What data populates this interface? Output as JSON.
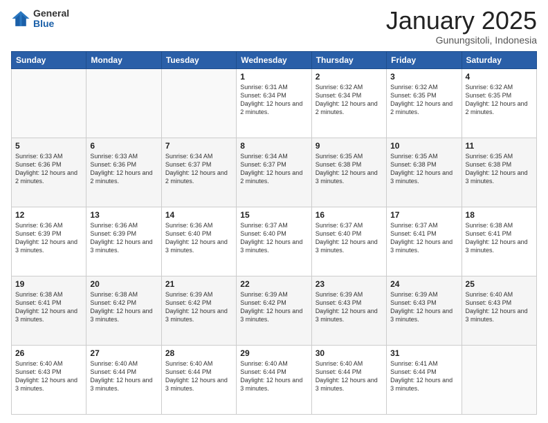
{
  "logo": {
    "general": "General",
    "blue": "Blue"
  },
  "header": {
    "title": "January 2025",
    "subtitle": "Gunungsitoli, Indonesia"
  },
  "days_of_week": [
    "Sunday",
    "Monday",
    "Tuesday",
    "Wednesday",
    "Thursday",
    "Friday",
    "Saturday"
  ],
  "weeks": [
    [
      {
        "day": "",
        "sunrise": "",
        "sunset": "",
        "daylight": ""
      },
      {
        "day": "",
        "sunrise": "",
        "sunset": "",
        "daylight": ""
      },
      {
        "day": "",
        "sunrise": "",
        "sunset": "",
        "daylight": ""
      },
      {
        "day": "1",
        "sunrise": "Sunrise: 6:31 AM",
        "sunset": "Sunset: 6:34 PM",
        "daylight": "Daylight: 12 hours and 2 minutes."
      },
      {
        "day": "2",
        "sunrise": "Sunrise: 6:32 AM",
        "sunset": "Sunset: 6:34 PM",
        "daylight": "Daylight: 12 hours and 2 minutes."
      },
      {
        "day": "3",
        "sunrise": "Sunrise: 6:32 AM",
        "sunset": "Sunset: 6:35 PM",
        "daylight": "Daylight: 12 hours and 2 minutes."
      },
      {
        "day": "4",
        "sunrise": "Sunrise: 6:32 AM",
        "sunset": "Sunset: 6:35 PM",
        "daylight": "Daylight: 12 hours and 2 minutes."
      }
    ],
    [
      {
        "day": "5",
        "sunrise": "Sunrise: 6:33 AM",
        "sunset": "Sunset: 6:36 PM",
        "daylight": "Daylight: 12 hours and 2 minutes."
      },
      {
        "day": "6",
        "sunrise": "Sunrise: 6:33 AM",
        "sunset": "Sunset: 6:36 PM",
        "daylight": "Daylight: 12 hours and 2 minutes."
      },
      {
        "day": "7",
        "sunrise": "Sunrise: 6:34 AM",
        "sunset": "Sunset: 6:37 PM",
        "daylight": "Daylight: 12 hours and 2 minutes."
      },
      {
        "day": "8",
        "sunrise": "Sunrise: 6:34 AM",
        "sunset": "Sunset: 6:37 PM",
        "daylight": "Daylight: 12 hours and 2 minutes."
      },
      {
        "day": "9",
        "sunrise": "Sunrise: 6:35 AM",
        "sunset": "Sunset: 6:38 PM",
        "daylight": "Daylight: 12 hours and 3 minutes."
      },
      {
        "day": "10",
        "sunrise": "Sunrise: 6:35 AM",
        "sunset": "Sunset: 6:38 PM",
        "daylight": "Daylight: 12 hours and 3 minutes."
      },
      {
        "day": "11",
        "sunrise": "Sunrise: 6:35 AM",
        "sunset": "Sunset: 6:38 PM",
        "daylight": "Daylight: 12 hours and 3 minutes."
      }
    ],
    [
      {
        "day": "12",
        "sunrise": "Sunrise: 6:36 AM",
        "sunset": "Sunset: 6:39 PM",
        "daylight": "Daylight: 12 hours and 3 minutes."
      },
      {
        "day": "13",
        "sunrise": "Sunrise: 6:36 AM",
        "sunset": "Sunset: 6:39 PM",
        "daylight": "Daylight: 12 hours and 3 minutes."
      },
      {
        "day": "14",
        "sunrise": "Sunrise: 6:36 AM",
        "sunset": "Sunset: 6:40 PM",
        "daylight": "Daylight: 12 hours and 3 minutes."
      },
      {
        "day": "15",
        "sunrise": "Sunrise: 6:37 AM",
        "sunset": "Sunset: 6:40 PM",
        "daylight": "Daylight: 12 hours and 3 minutes."
      },
      {
        "day": "16",
        "sunrise": "Sunrise: 6:37 AM",
        "sunset": "Sunset: 6:40 PM",
        "daylight": "Daylight: 12 hours and 3 minutes."
      },
      {
        "day": "17",
        "sunrise": "Sunrise: 6:37 AM",
        "sunset": "Sunset: 6:41 PM",
        "daylight": "Daylight: 12 hours and 3 minutes."
      },
      {
        "day": "18",
        "sunrise": "Sunrise: 6:38 AM",
        "sunset": "Sunset: 6:41 PM",
        "daylight": "Daylight: 12 hours and 3 minutes."
      }
    ],
    [
      {
        "day": "19",
        "sunrise": "Sunrise: 6:38 AM",
        "sunset": "Sunset: 6:41 PM",
        "daylight": "Daylight: 12 hours and 3 minutes."
      },
      {
        "day": "20",
        "sunrise": "Sunrise: 6:38 AM",
        "sunset": "Sunset: 6:42 PM",
        "daylight": "Daylight: 12 hours and 3 minutes."
      },
      {
        "day": "21",
        "sunrise": "Sunrise: 6:39 AM",
        "sunset": "Sunset: 6:42 PM",
        "daylight": "Daylight: 12 hours and 3 minutes."
      },
      {
        "day": "22",
        "sunrise": "Sunrise: 6:39 AM",
        "sunset": "Sunset: 6:42 PM",
        "daylight": "Daylight: 12 hours and 3 minutes."
      },
      {
        "day": "23",
        "sunrise": "Sunrise: 6:39 AM",
        "sunset": "Sunset: 6:43 PM",
        "daylight": "Daylight: 12 hours and 3 minutes."
      },
      {
        "day": "24",
        "sunrise": "Sunrise: 6:39 AM",
        "sunset": "Sunset: 6:43 PM",
        "daylight": "Daylight: 12 hours and 3 minutes."
      },
      {
        "day": "25",
        "sunrise": "Sunrise: 6:40 AM",
        "sunset": "Sunset: 6:43 PM",
        "daylight": "Daylight: 12 hours and 3 minutes."
      }
    ],
    [
      {
        "day": "26",
        "sunrise": "Sunrise: 6:40 AM",
        "sunset": "Sunset: 6:43 PM",
        "daylight": "Daylight: 12 hours and 3 minutes."
      },
      {
        "day": "27",
        "sunrise": "Sunrise: 6:40 AM",
        "sunset": "Sunset: 6:44 PM",
        "daylight": "Daylight: 12 hours and 3 minutes."
      },
      {
        "day": "28",
        "sunrise": "Sunrise: 6:40 AM",
        "sunset": "Sunset: 6:44 PM",
        "daylight": "Daylight: 12 hours and 3 minutes."
      },
      {
        "day": "29",
        "sunrise": "Sunrise: 6:40 AM",
        "sunset": "Sunset: 6:44 PM",
        "daylight": "Daylight: 12 hours and 3 minutes."
      },
      {
        "day": "30",
        "sunrise": "Sunrise: 6:40 AM",
        "sunset": "Sunset: 6:44 PM",
        "daylight": "Daylight: 12 hours and 3 minutes."
      },
      {
        "day": "31",
        "sunrise": "Sunrise: 6:41 AM",
        "sunset": "Sunset: 6:44 PM",
        "daylight": "Daylight: 12 hours and 3 minutes."
      },
      {
        "day": "",
        "sunrise": "",
        "sunset": "",
        "daylight": ""
      }
    ]
  ]
}
